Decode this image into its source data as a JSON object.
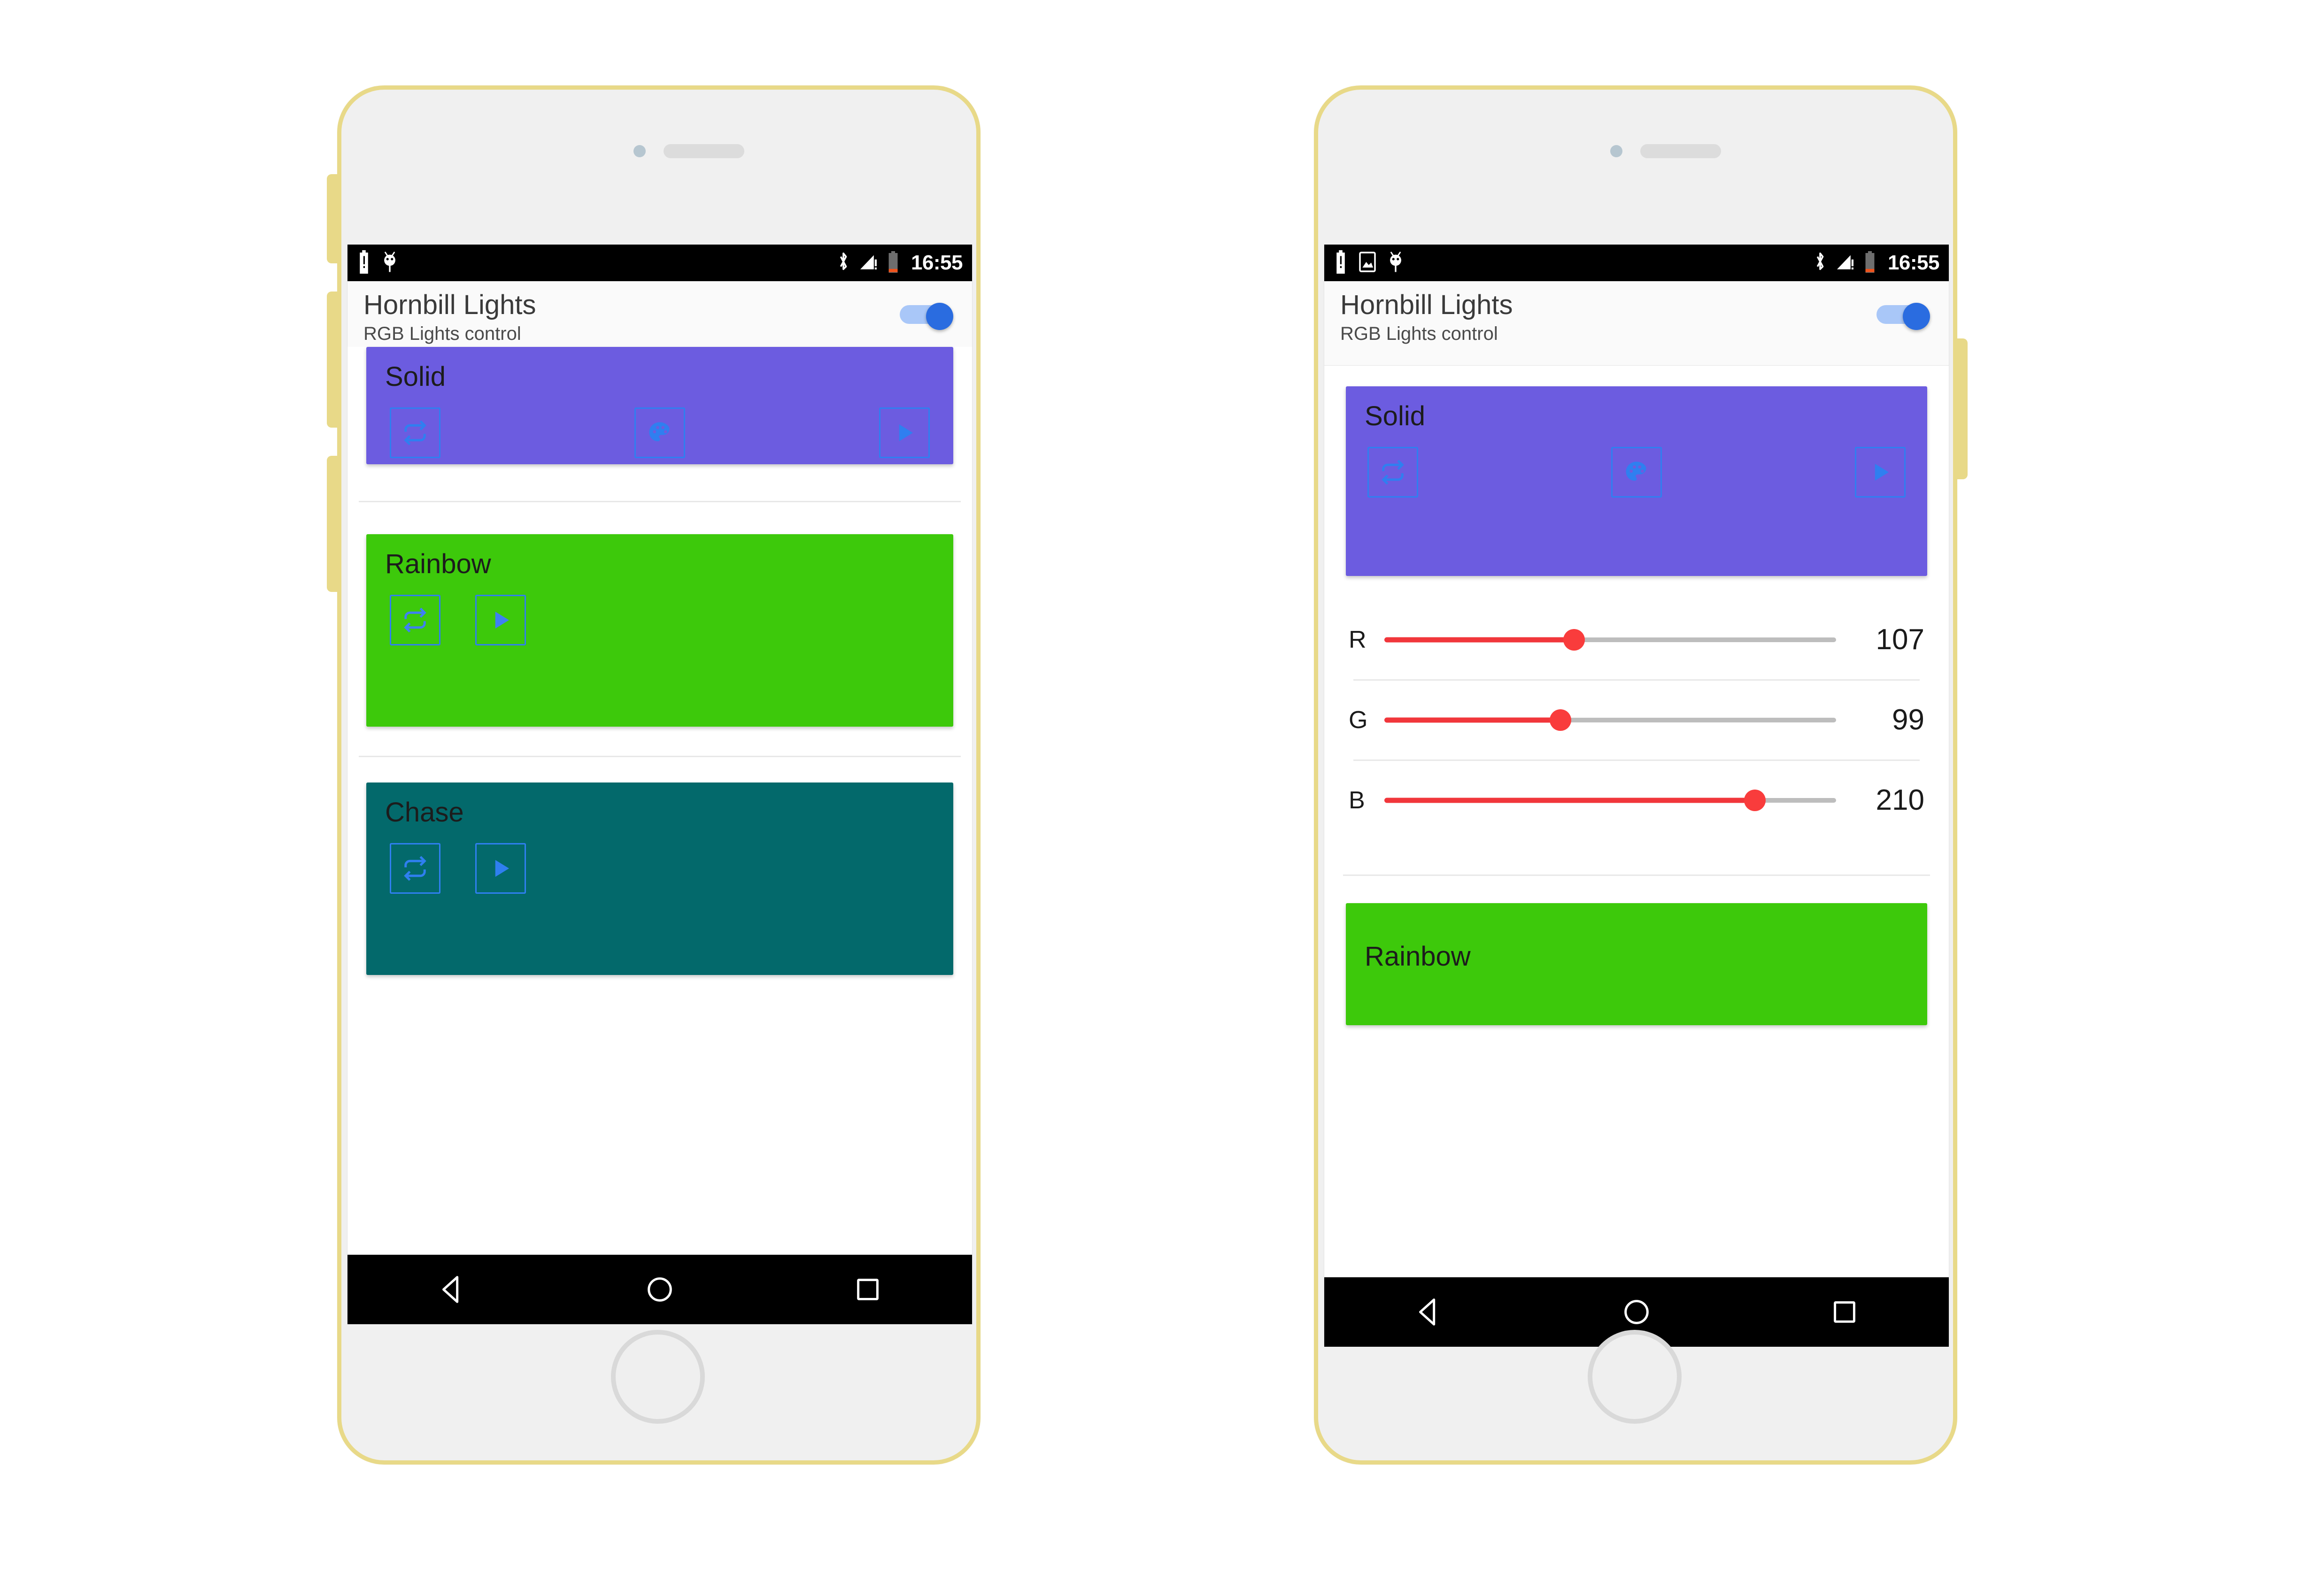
{
  "app": {
    "title": "Hornbill Lights",
    "subtitle": "RGB Lights control",
    "power_toggle": {
      "state": "on",
      "name": "power-switch"
    }
  },
  "status_bar": {
    "time": "16:55",
    "left_icons_phone1": [
      "battery-alert-icon",
      "adb-icon"
    ],
    "left_icons_phone2": [
      "battery-alert-icon",
      "screenshot-icon",
      "adb-icon"
    ],
    "right_icons": [
      "bluetooth-icon",
      "signal-alert-icon",
      "battery-low-icon"
    ]
  },
  "navigation_bar": {
    "back": "back-icon",
    "home": "home-icon",
    "recents": "recents-icon"
  },
  "colors": {
    "solid": "#6C5CE0",
    "rainbow": "#3DC90B",
    "chase": "#03696B",
    "accent_blue": "#2F7FF0",
    "slider_red": "#F93C3C",
    "slider_gray": "#BDBDBD",
    "frame_yellow": "#E8D988",
    "toggle_track": "#A9C7F8",
    "toggle_thumb": "#2A6CE0"
  },
  "phone_left": {
    "cards": [
      {
        "label": "Solid",
        "color": "#6C5CE0",
        "buttons": [
          "repeat-icon",
          "palette-icon",
          "play-icon"
        ]
      },
      {
        "label": "Rainbow",
        "color": "#3DC90B",
        "buttons": [
          "repeat-icon",
          "play-icon"
        ]
      },
      {
        "label": "Chase",
        "color": "#03696B",
        "buttons": [
          "repeat-icon",
          "play-icon"
        ]
      }
    ]
  },
  "phone_right": {
    "cards": [
      {
        "label": "Solid",
        "color": "#6C5CE0",
        "buttons": [
          "repeat-icon",
          "palette-icon",
          "play-icon"
        ]
      },
      {
        "label": "Rainbow",
        "color": "#3DC90B",
        "buttons": []
      }
    ],
    "rgb_sliders": [
      {
        "label": "R",
        "value": "107",
        "percent": 42
      },
      {
        "label": "G",
        "value": "99",
        "percent": 39
      },
      {
        "label": "B",
        "value": "210",
        "percent": 82
      }
    ]
  }
}
